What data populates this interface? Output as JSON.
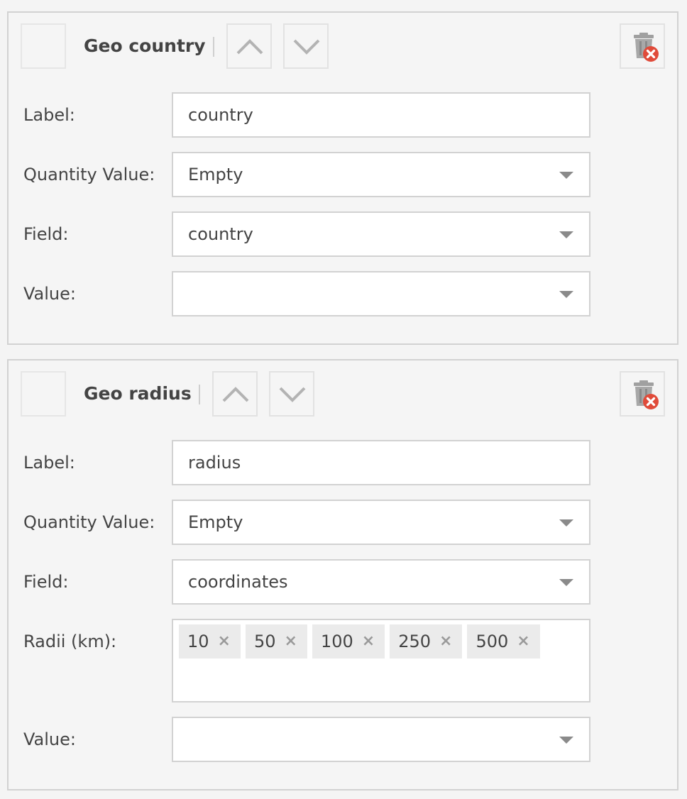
{
  "panels": [
    {
      "title": "Geo country",
      "fields": [
        {
          "label": "Label:",
          "value": "country",
          "type": "text"
        },
        {
          "label": "Quantity Value:",
          "value": "Empty",
          "type": "select"
        },
        {
          "label": "Field:",
          "value": "country",
          "type": "select"
        },
        {
          "label": "Value:",
          "value": "",
          "type": "select"
        }
      ]
    },
    {
      "title": "Geo radius",
      "fields": [
        {
          "label": "Label:",
          "value": "radius",
          "type": "text"
        },
        {
          "label": "Quantity Value:",
          "value": "Empty",
          "type": "select"
        },
        {
          "label": "Field:",
          "value": "coordinates",
          "type": "select"
        },
        {
          "label": "Radii (km):",
          "type": "tags",
          "tags": [
            "10",
            "50",
            "100",
            "250",
            "500"
          ]
        },
        {
          "label": "Value:",
          "value": "",
          "type": "select"
        }
      ]
    }
  ],
  "icons": {
    "move_up": "chevron-up-icon",
    "move_down": "chevron-down-icon",
    "delete": "trash-delete-icon",
    "tag_remove": "×"
  },
  "colors": {
    "panel_bg": "#f5f5f5",
    "border": "#d2d2d2",
    "delete_badge": "#e04b3a",
    "tag_bg": "#ebebeb"
  }
}
